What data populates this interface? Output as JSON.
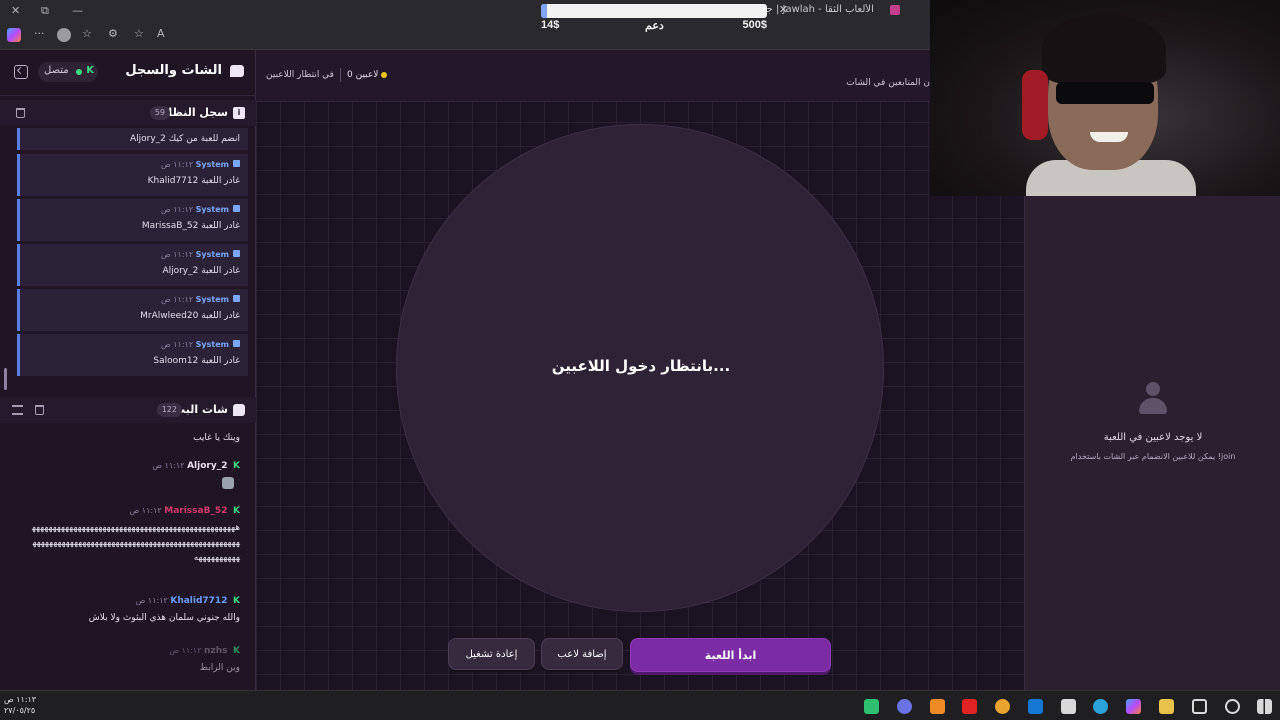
{
  "browser": {
    "tab_title": "جولة | Jawlah - منصة الألعاب الثقا",
    "tab_close": "✕",
    "window_close": "✕",
    "window_restore": "⧉",
    "window_minimize": "—",
    "more": "···",
    "reading": "A"
  },
  "donation": {
    "current": "14$",
    "label": "دعم",
    "goal": "500$",
    "progress_fraction": 0.028
  },
  "sidebar": {
    "title": "الشات والسجل",
    "status": "متصل",
    "status_icon": "K",
    "system_log": {
      "title": "سجل النظام",
      "count": "59",
      "icon": "i",
      "first_text": "Aljory_2 انضم للعبة من كيك",
      "items": [
        {
          "sender": "System",
          "time": "١١:١٢ ص",
          "text": "Khalid7712 غادر اللعبة"
        },
        {
          "sender": "System",
          "time": "١١:١٢ ص",
          "text": "MarissaB_52 غادر اللعبة"
        },
        {
          "sender": "System",
          "time": "١١:١٢ ص",
          "text": "Aljory_2 غادر اللعبة"
        },
        {
          "sender": "System",
          "time": "١١:١٢ ص",
          "text": "MrAlwleed20 غادر اللعبة"
        },
        {
          "sender": "System",
          "time": "١١:١٢ ص",
          "text": "Saloom12 غادر اللعبة"
        }
      ]
    },
    "stream_chat": {
      "title": "شات البث",
      "count": "122",
      "first_text": "وينك يا غايب",
      "messages": [
        {
          "user": "Aljory_2",
          "time": "١١:١٢ ص",
          "user_color": "#e8e0ee",
          "text": ""
        },
        {
          "user": "MarissaB_52",
          "time": "١١:١٢ ص",
          "user_color": "#d43a6a",
          "text": "ههههههههههههههههههههههههههههههههههههههههههههههههههههههههههههههههههههههههههههههههههههههههههههههههههههههههههههههه"
        },
        {
          "user": "Khalid7712",
          "time": "١١:١٢ ص",
          "user_color": "#6a9cff",
          "text": "والله جنوني سلمان هذي البثوث ولا بلاش"
        },
        {
          "user": "nzhs",
          "time": "١١:١٢ ص",
          "user_color": "#8a8094",
          "text": "وين الرابط"
        }
      ]
    }
  },
  "main": {
    "players_count": "0 لاعبين",
    "waiting_status": "في انتظار اللاعبين",
    "followers_note": "ن المتابعين في الشات",
    "circle_text": "بانتظار دخول اللاعبين...",
    "buttons": {
      "start": "ابدأ اللعبة",
      "add_player": "إضافة لاعب",
      "restart": "إعادة تشغيل"
    }
  },
  "players_panel": {
    "empty_title": "لا يوجد لاعبين في اللعبة",
    "empty_subtitle": "يمكن للاعبين الانضمام عبر الشات باستخدام !join"
  },
  "taskbar": {
    "time": "١١:١٣ ص",
    "date": "٢٧/٠٥/٢٥",
    "apps": [
      "screen-recorder-icon",
      "discord-icon",
      "vlc-icon",
      "youtube-icon",
      "chrome-icon",
      "outlook-icon",
      "store-icon",
      "edge-icon",
      "copilot-icon",
      "file-explorer-icon",
      "task-view-icon",
      "search-icon",
      "start-icon"
    ]
  },
  "colors": {
    "accent_purple": "#7b2ba4",
    "online_green": "#3ddc84",
    "system_blue": "#5b7fe0",
    "status_yellow": "#f5c518"
  }
}
